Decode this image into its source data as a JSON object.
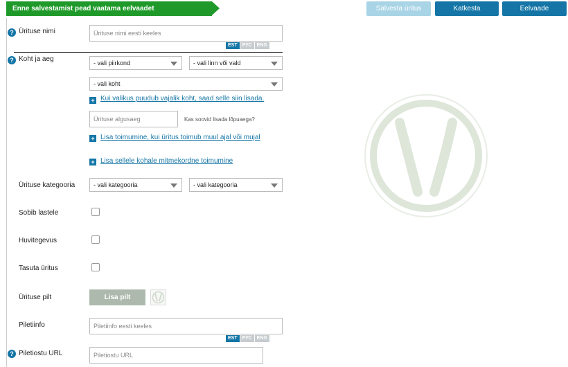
{
  "header": {
    "banner_text": "Enne salvestamist pead vaatama eelvaadet",
    "save_label": "Salvesta üritus",
    "cancel_label": "Katkesta",
    "preview_label": "Eelvaade"
  },
  "colors": {
    "banner": "#1f9a2a",
    "primary": "#1475a6",
    "disabled_button": "#a8d4e6",
    "lang_inactive": "#c6cccf"
  },
  "languages": {
    "est": "EST",
    "rus": "РУС",
    "eng": "ENG"
  },
  "form": {
    "event_name": {
      "label": "Ürituse nimi",
      "placeholder": "Ürituse nimi eesti keeles"
    },
    "place_time": {
      "label": "Koht ja aeg",
      "county_select": "- vali piirkond",
      "city_select": "- vali linn või vald",
      "place_select": "- vali koht",
      "add_place_link": "Kui valikus puudub vajalik koht, saad selle siin lisada.",
      "start_time_placeholder": "Ürituse algusaeg",
      "end_time_hint": "Kas soovid lisada lõpuaega?",
      "add_occurrence_link": "Lisa toimumine, kui üritus toimub muul ajal või mujal",
      "add_multiple_link": "Lisa sellele kohale mitmekordne toimumine"
    },
    "category": {
      "label": "Ürituse kategooria",
      "select1": "- vali kategooria",
      "select2": "- vali kategooria"
    },
    "kids": {
      "label": "Sobib lastele"
    },
    "hobby": {
      "label": "Huvitegevus"
    },
    "free": {
      "label": "Tasuta üritus"
    },
    "picture": {
      "label": "Ürituse pilt",
      "button": "Lisa pilt"
    },
    "ticket_info": {
      "label": "Piletiinfo",
      "placeholder": "Piletiinfo eesti keeles"
    },
    "ticket_url": {
      "label": "Piletiostu URL",
      "placeholder": "Piletiostu URL"
    }
  },
  "icons": {
    "help": "?",
    "plus": "+"
  }
}
